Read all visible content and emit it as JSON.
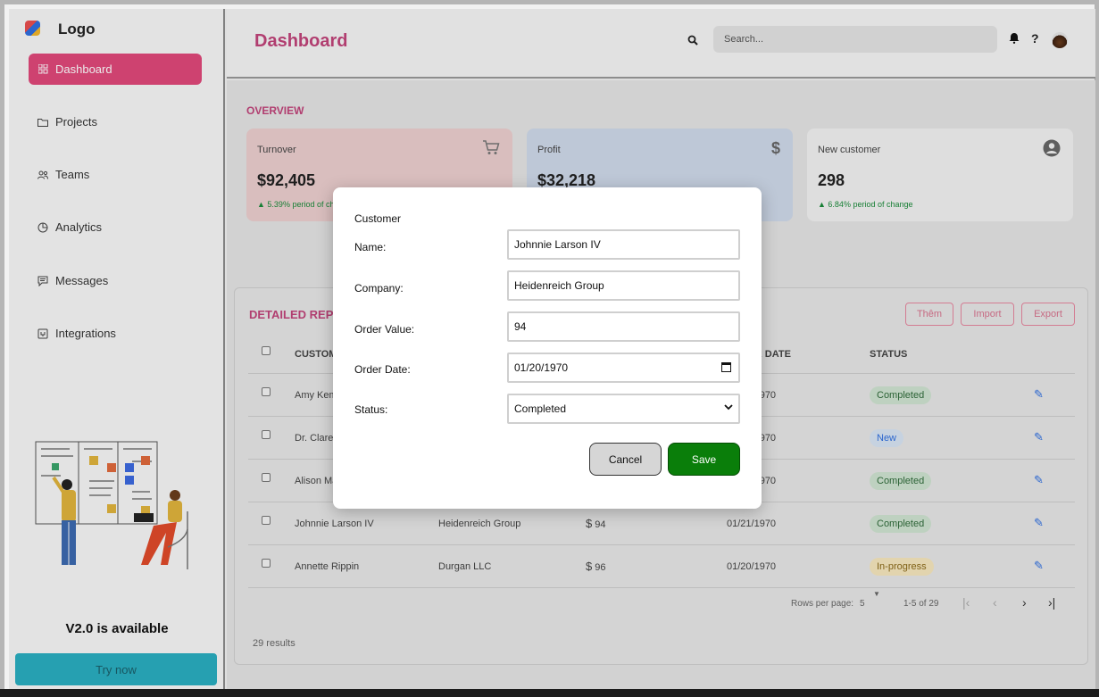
{
  "sidebar": {
    "logo": "Logo",
    "items": [
      {
        "label": "Dashboard",
        "icon": "grid-icon",
        "active": true
      },
      {
        "label": "Projects",
        "icon": "folder-icon"
      },
      {
        "label": "Teams",
        "icon": "users-icon"
      },
      {
        "label": "Analytics",
        "icon": "pie-chart-icon"
      },
      {
        "label": "Messages",
        "icon": "message-icon"
      },
      {
        "label": "Integrations",
        "icon": "plug-icon"
      }
    ],
    "version_text": "V2.0 is available",
    "try_label": "Try now"
  },
  "header": {
    "title": "Dashboard",
    "search_placeholder": "Search..."
  },
  "overview": {
    "title": "OVERVIEW",
    "cards": [
      {
        "label": "Turnover",
        "value": "$92,405",
        "change": "5.39% period of change",
        "icon": "cart-icon",
        "color": "#eccfcf"
      },
      {
        "label": "Profit",
        "value": "$32,218",
        "change": "",
        "icon": "dollar-icon",
        "color": "#cfd9ea"
      },
      {
        "label": "New customer",
        "value": "298",
        "change": "6.84% period of change",
        "icon": "user-circle-icon",
        "color": "#f1f1f1"
      }
    ]
  },
  "report": {
    "title": "DETAILED REPORT",
    "buttons": {
      "add": "Thêm",
      "import": "Import",
      "export": "Export"
    },
    "columns": {
      "customer": "CUSTOMER",
      "date": "ORDER DATE",
      "status": "STATUS"
    },
    "rows": [
      {
        "customer": "Amy Kemmer",
        "company": "",
        "value": "",
        "date": "01/20/1970",
        "status": "Completed"
      },
      {
        "customer": "Dr. Clarence",
        "company": "",
        "value": "",
        "date": "01/20/1970",
        "status": "New"
      },
      {
        "customer": "Alison Mayer",
        "company": "",
        "value": "",
        "date": "01/20/1970",
        "status": "Completed"
      },
      {
        "customer": "Johnnie Larson IV",
        "company": "Heidenreich Group",
        "value": "94",
        "date": "01/21/1970",
        "status": "Completed"
      },
      {
        "customer": "Annette Rippin",
        "company": "Durgan LLC",
        "value": "96",
        "date": "01/20/1970",
        "status": "In-progress"
      }
    ],
    "rows_per_page_label": "Rows per page:",
    "rows_per_page": "5",
    "range": "1-5 of 29",
    "results": "29 results",
    "status_colors": {
      "Completed": "#cfe3d1",
      "New": "#d7e4f3",
      "In-progress": "#f6e6bd"
    },
    "status_text_colors": {
      "Completed": "#2f6b3a",
      "New": "#2f6fe0",
      "In-progress": "#8a6a1a"
    }
  },
  "modal": {
    "title": "Customer",
    "fields": [
      {
        "label": "Name:",
        "value": "Johnnie Larson IV"
      },
      {
        "label": "Company:",
        "value": "Heidenreich Group"
      },
      {
        "label": "Order Value:",
        "value": "94"
      },
      {
        "label": "Order Date:",
        "value": "01/20/1970"
      },
      {
        "label": "Status:",
        "value": "Completed"
      }
    ],
    "cancel": "Cancel",
    "save": "Save"
  }
}
